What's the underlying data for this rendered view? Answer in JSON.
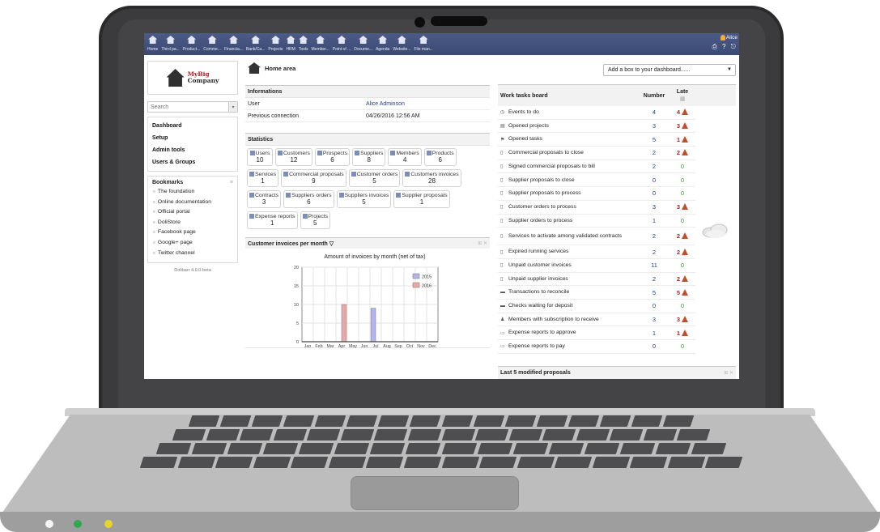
{
  "menu": [
    {
      "label": "Home",
      "icon": "home-icon"
    },
    {
      "label": "Third pa...",
      "icon": "thirdparty-icon"
    },
    {
      "label": "Product...",
      "icon": "product-icon"
    },
    {
      "label": "Comme...",
      "icon": "commercial-icon"
    },
    {
      "label": "Financia...",
      "icon": "financial-icon"
    },
    {
      "label": "Bank/Ca...",
      "icon": "bank-icon"
    },
    {
      "label": "Projects",
      "icon": "projects-icon"
    },
    {
      "label": "HRM",
      "icon": "hrm-icon"
    },
    {
      "label": "Tools",
      "icon": "tools-icon"
    },
    {
      "label": "Member...",
      "icon": "members-icon"
    },
    {
      "label": "Point of ...",
      "icon": "pos-icon"
    },
    {
      "label": "Docume...",
      "icon": "documents-icon"
    },
    {
      "label": "Agenda",
      "icon": "agenda-icon"
    },
    {
      "label": "Website...",
      "icon": "website-icon"
    },
    {
      "label": "File man...",
      "icon": "filemanager-icon"
    }
  ],
  "user": {
    "name": "Alice",
    "tools": "⎙ ? ⎋"
  },
  "logo": {
    "line1": "MyBig",
    "line2": "Company"
  },
  "search": {
    "placeholder": "Search",
    "button": "▾"
  },
  "main_menu": [
    "Dashboard",
    "Setup",
    "Admin tools",
    "Users & Groups"
  ],
  "bookmarks": {
    "title": "Bookmarks",
    "items": [
      "The foundation",
      "Online documentation",
      "Official portal",
      "DoliStore",
      "Facebook page",
      "Google+ page",
      "Twitter channel"
    ]
  },
  "version": "Dolibarr 4.0.0-beta",
  "home_title": "Home area",
  "informations": {
    "title": "Informations",
    "rows": [
      {
        "key": "User",
        "value": "Alice Adminson"
      },
      {
        "key": "Previous connection",
        "value": "04/26/2016 12:56 AM"
      }
    ]
  },
  "statistics": {
    "title": "Statistics",
    "boxes": [
      {
        "label": "Users",
        "value": "10"
      },
      {
        "label": "Customers",
        "value": "12"
      },
      {
        "label": "Prospects",
        "value": "6"
      },
      {
        "label": "Suppliers",
        "value": "8"
      },
      {
        "label": "Members",
        "value": "4"
      },
      {
        "label": "Products",
        "value": "6"
      },
      {
        "label": "Services",
        "value": "1"
      },
      {
        "label": "Commercial proposals",
        "value": "9"
      },
      {
        "label": "Customer orders",
        "value": "5"
      },
      {
        "label": "Customers invoices",
        "value": "28"
      },
      {
        "label": "Contracts",
        "value": "3"
      },
      {
        "label": "Suppliers orders",
        "value": "6"
      },
      {
        "label": "Suppliers invoices",
        "value": "5"
      },
      {
        "label": "Supplier proposals",
        "value": "1"
      },
      {
        "label": "Expense reports",
        "value": "1"
      },
      {
        "label": "Projects",
        "value": "5"
      }
    ]
  },
  "chart_box": {
    "title": "Customer invoices per month ▽",
    "controls": "⊞ ✕"
  },
  "chart_data": {
    "type": "bar",
    "title": "Amount of invoices by month (net of tax)",
    "categories": [
      "Jan",
      "Feb",
      "Mar",
      "Apr",
      "May",
      "Jun",
      "Jul",
      "Aug",
      "Sep",
      "Oct",
      "Nov",
      "Dec"
    ],
    "series": [
      {
        "name": "2015",
        "color": "#b4b4ee",
        "values": [
          0,
          0,
          0,
          0,
          0,
          0,
          9,
          0,
          0,
          0,
          0,
          0
        ]
      },
      {
        "name": "2016",
        "color": "#e8a8a8",
        "values": [
          0,
          0,
          0,
          10,
          0,
          0,
          0,
          0,
          0,
          0,
          0,
          0
        ]
      }
    ],
    "ylim": [
      0,
      20
    ],
    "yticks": [
      0,
      5,
      10,
      15,
      20
    ],
    "legend": "top-right",
    "grid": true
  },
  "dashboard_select": {
    "value": "Add a box to your dashboard......"
  },
  "work_tasks": {
    "title": "Work tasks board",
    "col_number": "Number",
    "col_late": "Late",
    "rows": [
      {
        "label": "Events to do",
        "number": "4",
        "late": "4",
        "warn": true
      },
      {
        "label": "Opened projects",
        "number": "3",
        "late": "3",
        "warn": true
      },
      {
        "label": "Opened tasks",
        "number": "5",
        "late": "1",
        "warn": true
      },
      {
        "label": "Commercial proposals to close",
        "number": "2",
        "late": "2",
        "warn": true
      },
      {
        "label": "Signed commercial proposals to bill",
        "number": "2",
        "late": "0",
        "warn": false
      },
      {
        "label": "Supplier proposals to close",
        "number": "0",
        "late": "0",
        "warn": false
      },
      {
        "label": "Supplier proposals to process",
        "number": "0",
        "late": "0",
        "warn": false
      },
      {
        "label": "Customer orders to process",
        "number": "3",
        "late": "3",
        "warn": true
      },
      {
        "label": "Supplier orders to process",
        "number": "1",
        "late": "0",
        "warn": false
      },
      {
        "label": "Services to activate among validated contracts",
        "number": "2",
        "late": "2",
        "warn": true
      },
      {
        "label": "Expired running services",
        "number": "2",
        "late": "2",
        "warn": true
      },
      {
        "label": "Unpaid customer invoices",
        "number": "11",
        "late": "0",
        "warn": false
      },
      {
        "label": "Unpaid supplier invoices",
        "number": "2",
        "late": "2",
        "warn": true
      },
      {
        "label": "Transactions to reconcile",
        "number": "5",
        "late": "5",
        "warn": true
      },
      {
        "label": "Checks waiting for deposit",
        "number": "0",
        "late": "0",
        "warn": false
      },
      {
        "label": "Members with subscription to receive",
        "number": "3",
        "late": "3",
        "warn": true
      },
      {
        "label": "Expense reports to approve",
        "number": "1",
        "late": "1",
        "warn": true
      },
      {
        "label": "Expense reports to pay",
        "number": "0",
        "late": "0",
        "warn": false
      }
    ]
  },
  "last5": {
    "title": "Last 5 modified proposals",
    "controls": "⊞ ✕"
  }
}
